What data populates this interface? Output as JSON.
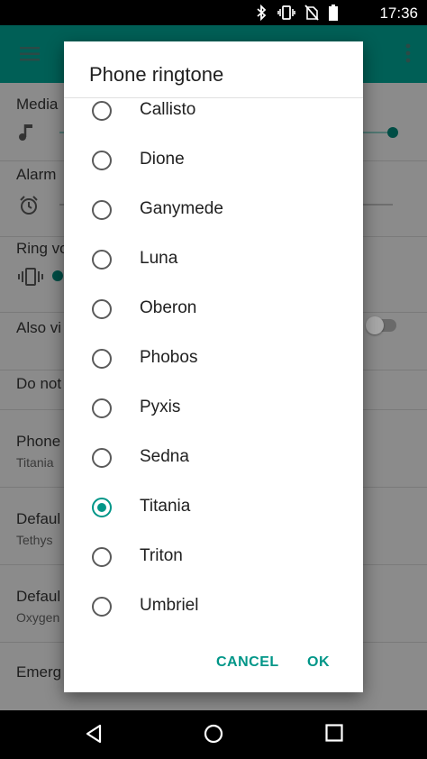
{
  "status_bar": {
    "time": "17:36",
    "icons": [
      "bluetooth-icon",
      "vibrate-icon",
      "no-sim-icon",
      "battery-icon"
    ]
  },
  "settings_background": {
    "rows": [
      {
        "title": "Media",
        "subtitle": ""
      },
      {
        "title": "Alarm",
        "subtitle": ""
      },
      {
        "title": "Ring vo",
        "subtitle": ""
      },
      {
        "title": "Also vi",
        "subtitle": ""
      },
      {
        "title": "Do not",
        "subtitle": ""
      },
      {
        "title": "Phone",
        "subtitle": "Titania"
      },
      {
        "title": "Defaul",
        "subtitle": "Tethys"
      },
      {
        "title": "Defaul",
        "subtitle": "Oxygen"
      },
      {
        "title": "Emerg",
        "subtitle": ""
      }
    ]
  },
  "dialog": {
    "title": "Phone ringtone",
    "selected": "Titania",
    "options": [
      {
        "label": "Callisto",
        "checked": false
      },
      {
        "label": "Dione",
        "checked": false
      },
      {
        "label": "Ganymede",
        "checked": false
      },
      {
        "label": "Luna",
        "checked": false
      },
      {
        "label": "Oberon",
        "checked": false
      },
      {
        "label": "Phobos",
        "checked": false
      },
      {
        "label": "Pyxis",
        "checked": false
      },
      {
        "label": "Sedna",
        "checked": false
      },
      {
        "label": "Titania",
        "checked": true
      },
      {
        "label": "Triton",
        "checked": false
      },
      {
        "label": "Umbriel",
        "checked": false
      }
    ],
    "cancel_label": "CANCEL",
    "ok_label": "OK"
  },
  "colors": {
    "accent": "#009688",
    "toolbar": "#005f56",
    "scrim": "#8b8b8b"
  }
}
